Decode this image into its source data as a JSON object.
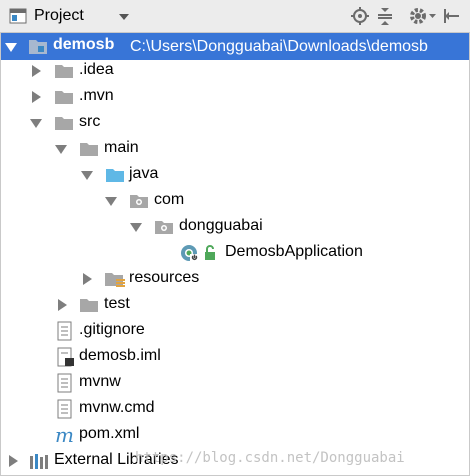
{
  "toolbar": {
    "title": "Project",
    "icons": [
      "project-view-icon",
      "dropdown-arrow-icon",
      "locate-icon",
      "collapse-icon",
      "settings-icon",
      "hide-icon"
    ]
  },
  "tree": {
    "root": {
      "name": "demosb",
      "path": "C:\\Users\\Dongguabai\\Downloads\\demosb"
    },
    "idea": ".idea",
    "mvn": ".mvn",
    "src": "src",
    "main": "main",
    "java": "java",
    "com": "com",
    "dongguabai": "dongguabai",
    "app": "DemosbApplication",
    "resources": "resources",
    "test": "test",
    "gitignore": ".gitignore",
    "iml": "demosb.iml",
    "mvnw": "mvnw",
    "mvnwcmd": "mvnw.cmd",
    "pom": "pom.xml",
    "extlibs": "External Libraries"
  },
  "watermark": "https://blog.csdn.net/Dongguabai",
  "colors": {
    "selection": "#3875d7",
    "folder": "#a7a7a7",
    "source_folder": "#5fb8e6",
    "maven": "#3b88c4"
  }
}
